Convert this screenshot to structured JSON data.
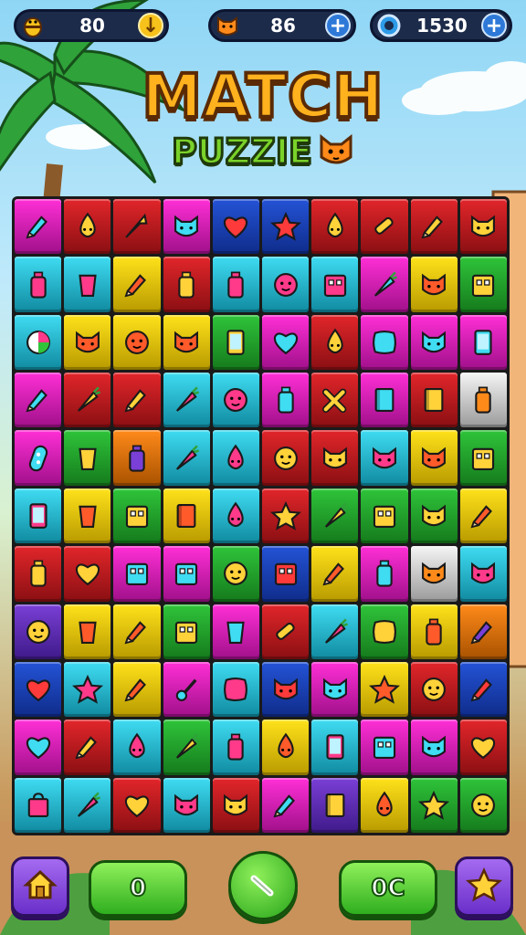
{
  "currencies": {
    "honey": {
      "value": "80",
      "icon": "honey-bee-icon",
      "action_icon": "download-arrow-icon"
    },
    "cat": {
      "value": "86",
      "icon": "cat-face-icon",
      "action_icon": "plus-icon"
    },
    "gems": {
      "value": "1530",
      "icon": "gem-ring-icon",
      "action_icon": "plus-icon"
    }
  },
  "title": {
    "main": "MATCH",
    "sub": "PUZZIE",
    "mascot_icon": "cat-face-icon"
  },
  "bottom_bar": {
    "home_icon": "home-icon",
    "left_counter": "0",
    "center_icon": "clock-hand-icon",
    "right_counter": "0C",
    "star_icon": "star-icon"
  },
  "colors": {
    "magenta": "#ff2fd6",
    "red": "#e2262b",
    "blue": "#2453d6",
    "yellow": "#ffe21a",
    "cyan": "#3fdcf2",
    "green": "#2fc43a",
    "purple": "#7a3fd6",
    "white": "#f5f5f5",
    "orange": "#ff8a1a"
  },
  "board": {
    "rows": [
      [
        [
          "magenta",
          "pencil"
        ],
        [
          "red",
          "drop-face"
        ],
        [
          "red",
          "arrow"
        ],
        [
          "magenta",
          "cat-face"
        ],
        [
          "blue",
          "heart"
        ],
        [
          "blue",
          "star"
        ],
        [
          "red",
          "drop-face"
        ],
        [
          "red",
          "tube"
        ],
        [
          "red",
          "pencil"
        ],
        [
          "red",
          "cat-face"
        ]
      ],
      [
        [
          "cyan",
          "bottle"
        ],
        [
          "cyan",
          "cup"
        ],
        [
          "yellow",
          "pencil"
        ],
        [
          "red",
          "bottle"
        ],
        [
          "cyan",
          "bottle"
        ],
        [
          "cyan",
          "round-face"
        ],
        [
          "cyan",
          "box"
        ],
        [
          "magenta",
          "carrot"
        ],
        [
          "yellow",
          "cat-face"
        ],
        [
          "green",
          "box"
        ]
      ],
      [
        [
          "cyan",
          "circle"
        ],
        [
          "yellow",
          "cat-face"
        ],
        [
          "yellow",
          "round-face"
        ],
        [
          "yellow",
          "cat-face"
        ],
        [
          "green",
          "phone"
        ],
        [
          "magenta",
          "heart"
        ],
        [
          "red",
          "drop-face"
        ],
        [
          "magenta",
          "pillow"
        ],
        [
          "magenta",
          "cat-face"
        ],
        [
          "magenta",
          "phone"
        ]
      ],
      [
        [
          "magenta",
          "pencil"
        ],
        [
          "red",
          "carrot"
        ],
        [
          "red",
          "pencil"
        ],
        [
          "cyan",
          "carrot"
        ],
        [
          "cyan",
          "round-face"
        ],
        [
          "magenta",
          "bottle"
        ],
        [
          "red",
          "cross"
        ],
        [
          "magenta",
          "book"
        ],
        [
          "red",
          "book"
        ],
        [
          "white",
          "bottle"
        ]
      ],
      [
        [
          "magenta",
          "capsule"
        ],
        [
          "green",
          "cup"
        ],
        [
          "orange",
          "bottle"
        ],
        [
          "cyan",
          "carrot"
        ],
        [
          "cyan",
          "drop-face"
        ],
        [
          "red",
          "round-face"
        ],
        [
          "red",
          "cat-face"
        ],
        [
          "cyan",
          "cat-face"
        ],
        [
          "yellow",
          "cat-face"
        ],
        [
          "green",
          "box"
        ]
      ],
      [
        [
          "cyan",
          "phone"
        ],
        [
          "yellow",
          "cup"
        ],
        [
          "green",
          "box"
        ],
        [
          "yellow",
          "book"
        ],
        [
          "cyan",
          "drop-face"
        ],
        [
          "red",
          "star"
        ],
        [
          "green",
          "carrot"
        ],
        [
          "green",
          "box"
        ],
        [
          "green",
          "cat-face"
        ],
        [
          "yellow",
          "pencil"
        ]
      ],
      [
        [
          "red",
          "bottle"
        ],
        [
          "red",
          "heart"
        ],
        [
          "magenta",
          "box"
        ],
        [
          "magenta",
          "box"
        ],
        [
          "green",
          "round-face"
        ],
        [
          "blue",
          "box"
        ],
        [
          "yellow",
          "pencil"
        ],
        [
          "magenta",
          "bottle"
        ],
        [
          "white",
          "cat-face"
        ],
        [
          "cyan",
          "cat-face"
        ]
      ],
      [
        [
          "purple",
          "round-face"
        ],
        [
          "yellow",
          "cup"
        ],
        [
          "yellow",
          "pencil"
        ],
        [
          "green",
          "box"
        ],
        [
          "magenta",
          "cup"
        ],
        [
          "red",
          "tube"
        ],
        [
          "cyan",
          "carrot"
        ],
        [
          "green",
          "pillow"
        ],
        [
          "yellow",
          "bottle"
        ],
        [
          "orange",
          "pencil"
        ]
      ],
      [
        [
          "blue",
          "heart"
        ],
        [
          "cyan",
          "star"
        ],
        [
          "yellow",
          "pencil"
        ],
        [
          "magenta",
          "key"
        ],
        [
          "cyan",
          "pillow"
        ],
        [
          "blue",
          "cat-face"
        ],
        [
          "magenta",
          "cat-face"
        ],
        [
          "yellow",
          "star"
        ],
        [
          "red",
          "round-face"
        ],
        [
          "blue",
          "pencil"
        ]
      ],
      [
        [
          "magenta",
          "heart"
        ],
        [
          "red",
          "pencil"
        ],
        [
          "cyan",
          "drop-face"
        ],
        [
          "green",
          "carrot"
        ],
        [
          "cyan",
          "bottle"
        ],
        [
          "yellow",
          "drop-face"
        ],
        [
          "cyan",
          "phone"
        ],
        [
          "magenta",
          "box"
        ],
        [
          "magenta",
          "cat-face"
        ],
        [
          "red",
          "heart"
        ]
      ],
      [
        [
          "cyan",
          "bag"
        ],
        [
          "cyan",
          "carrot"
        ],
        [
          "red",
          "heart"
        ],
        [
          "cyan",
          "cat-face"
        ],
        [
          "red",
          "cat-face"
        ],
        [
          "magenta",
          "pencil"
        ],
        [
          "purple",
          "book"
        ],
        [
          "yellow",
          "drop-face"
        ],
        [
          "green",
          "star"
        ],
        [
          "green",
          "round-face"
        ]
      ]
    ]
  }
}
